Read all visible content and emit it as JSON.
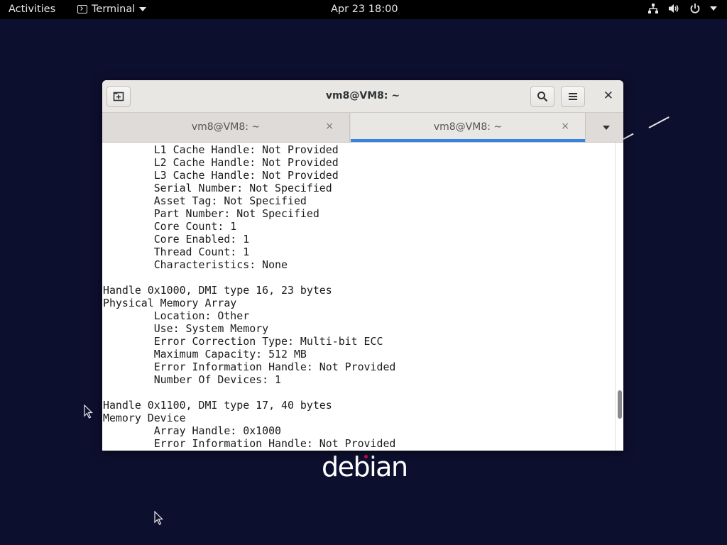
{
  "topbar": {
    "activities": "Activities",
    "app_name": "Terminal",
    "clock": "Apr 23  18:00",
    "icons": [
      "network-icon",
      "volume-icon",
      "power-icon",
      "chevron-down-icon"
    ]
  },
  "desktop": {
    "logo_text": "debian",
    "logo_dot_color": "#d70751",
    "background_color": "#0d0f2e"
  },
  "window": {
    "title": "vm8@VM8: ~",
    "new_tab_icon": "new-tab-icon",
    "search_icon": "search-icon",
    "menu_icon": "hamburger-menu-icon",
    "close": "✕",
    "tabs": [
      {
        "label": "vm8@VM8: ~",
        "close": "×",
        "active": false
      },
      {
        "label": "vm8@VM8: ~",
        "close": "×",
        "active": true
      }
    ],
    "active_tab_color": "#3584e4"
  },
  "terminal": {
    "lines": [
      "        L1 Cache Handle: Not Provided",
      "        L2 Cache Handle: Not Provided",
      "        L3 Cache Handle: Not Provided",
      "        Serial Number: Not Specified",
      "        Asset Tag: Not Specified",
      "        Part Number: Not Specified",
      "        Core Count: 1",
      "        Core Enabled: 1",
      "        Thread Count: 1",
      "        Characteristics: None",
      "",
      "Handle 0x1000, DMI type 16, 23 bytes",
      "Physical Memory Array",
      "        Location: Other",
      "        Use: System Memory",
      "        Error Correction Type: Multi-bit ECC",
      "        Maximum Capacity: 512 MB",
      "        Error Information Handle: Not Provided",
      "        Number Of Devices: 1",
      "",
      "Handle 0x1100, DMI type 17, 40 bytes",
      "Memory Device",
      "        Array Handle: 0x1000",
      "        Error Information Handle: Not Provided"
    ]
  }
}
